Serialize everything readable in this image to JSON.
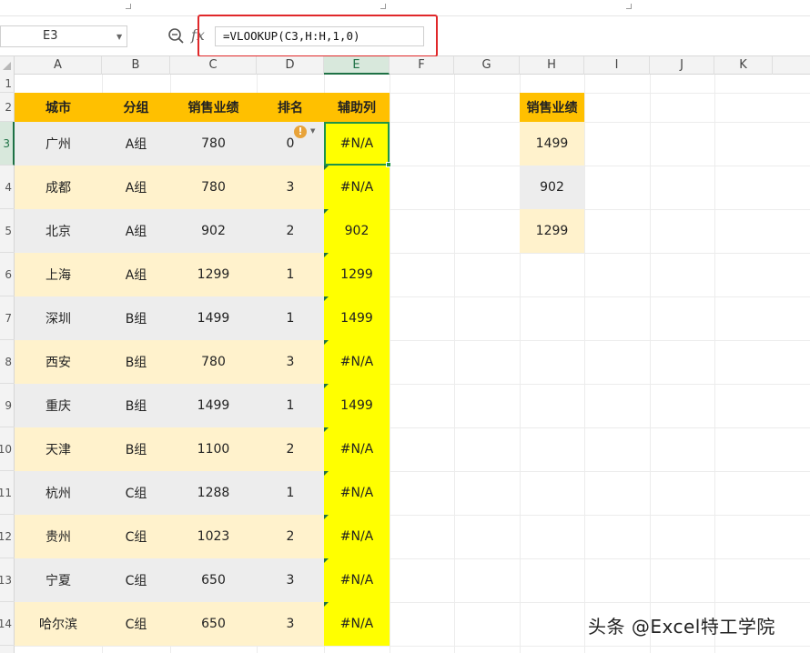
{
  "formula_bar": {
    "name_box": "E3",
    "formula": "=VLOOKUP(C3,H:H,1,0)",
    "fx_label": "fx"
  },
  "columns": [
    "A",
    "B",
    "C",
    "D",
    "E",
    "F",
    "G",
    "H",
    "I",
    "J",
    "K"
  ],
  "rows": [
    "1",
    "2",
    "3",
    "4",
    "5",
    "6",
    "7",
    "8",
    "9",
    "10",
    "11",
    "12",
    "13",
    "14"
  ],
  "table": {
    "headers": [
      "城市",
      "分组",
      "销售业绩",
      "排名",
      "辅助列"
    ],
    "rows": [
      [
        "广州",
        "A组",
        "780",
        "0",
        "#N/A"
      ],
      [
        "成都",
        "A组",
        "780",
        "3",
        "#N/A"
      ],
      [
        "北京",
        "A组",
        "902",
        "2",
        "902"
      ],
      [
        "上海",
        "A组",
        "1299",
        "1",
        "1299"
      ],
      [
        "深圳",
        "B组",
        "1499",
        "1",
        "1499"
      ],
      [
        "西安",
        "B组",
        "780",
        "3",
        "#N/A"
      ],
      [
        "重庆",
        "B组",
        "1499",
        "1",
        "1499"
      ],
      [
        "天津",
        "B组",
        "1100",
        "2",
        "#N/A"
      ],
      [
        "杭州",
        "C组",
        "1288",
        "1",
        "#N/A"
      ],
      [
        "贵州",
        "C组",
        "1023",
        "2",
        "#N/A"
      ],
      [
        "宁夏",
        "C组",
        "650",
        "3",
        "#N/A"
      ],
      [
        "哈尔滨",
        "C组",
        "650",
        "3",
        "#N/A"
      ]
    ]
  },
  "lookup_table": {
    "header": "销售业绩",
    "values": [
      "1499",
      "902",
      "1299"
    ]
  },
  "colors": {
    "header_bg": "#ffc000",
    "helper_col_bg": "#ffff00",
    "row_odd_bg": "#ededed",
    "row_even_bg": "#fff2cc",
    "selection": "#1e9449",
    "highlight_box": "#e0282a"
  },
  "warning_icon": "!",
  "watermark": "头条 @Excel特工学院"
}
